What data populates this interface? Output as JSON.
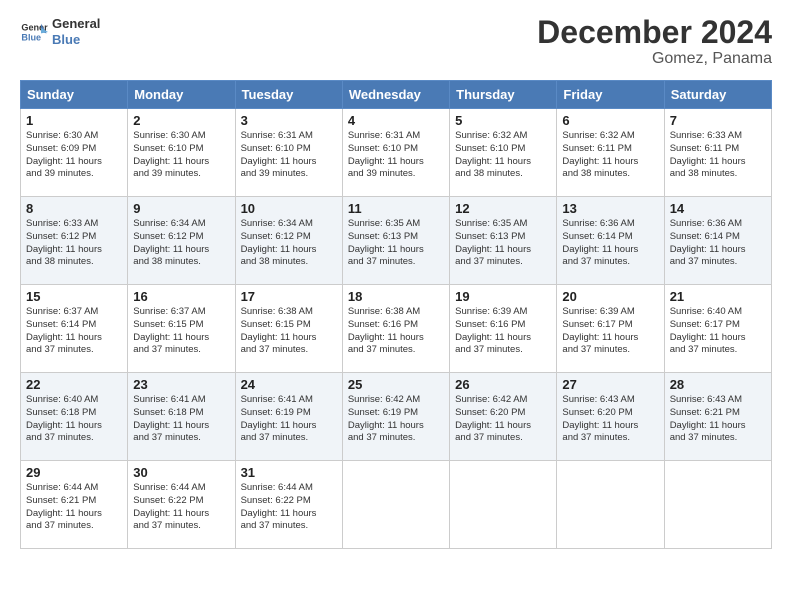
{
  "header": {
    "logo_line1": "General",
    "logo_line2": "Blue",
    "month_title": "December 2024",
    "location": "Gomez, Panama"
  },
  "weekdays": [
    "Sunday",
    "Monday",
    "Tuesday",
    "Wednesday",
    "Thursday",
    "Friday",
    "Saturday"
  ],
  "weeks": [
    [
      {
        "day": "1",
        "info": "Sunrise: 6:30 AM\nSunset: 6:09 PM\nDaylight: 11 hours\nand 39 minutes."
      },
      {
        "day": "2",
        "info": "Sunrise: 6:30 AM\nSunset: 6:10 PM\nDaylight: 11 hours\nand 39 minutes."
      },
      {
        "day": "3",
        "info": "Sunrise: 6:31 AM\nSunset: 6:10 PM\nDaylight: 11 hours\nand 39 minutes."
      },
      {
        "day": "4",
        "info": "Sunrise: 6:31 AM\nSunset: 6:10 PM\nDaylight: 11 hours\nand 39 minutes."
      },
      {
        "day": "5",
        "info": "Sunrise: 6:32 AM\nSunset: 6:10 PM\nDaylight: 11 hours\nand 38 minutes."
      },
      {
        "day": "6",
        "info": "Sunrise: 6:32 AM\nSunset: 6:11 PM\nDaylight: 11 hours\nand 38 minutes."
      },
      {
        "day": "7",
        "info": "Sunrise: 6:33 AM\nSunset: 6:11 PM\nDaylight: 11 hours\nand 38 minutes."
      }
    ],
    [
      {
        "day": "8",
        "info": "Sunrise: 6:33 AM\nSunset: 6:12 PM\nDaylight: 11 hours\nand 38 minutes."
      },
      {
        "day": "9",
        "info": "Sunrise: 6:34 AM\nSunset: 6:12 PM\nDaylight: 11 hours\nand 38 minutes."
      },
      {
        "day": "10",
        "info": "Sunrise: 6:34 AM\nSunset: 6:12 PM\nDaylight: 11 hours\nand 38 minutes."
      },
      {
        "day": "11",
        "info": "Sunrise: 6:35 AM\nSunset: 6:13 PM\nDaylight: 11 hours\nand 37 minutes."
      },
      {
        "day": "12",
        "info": "Sunrise: 6:35 AM\nSunset: 6:13 PM\nDaylight: 11 hours\nand 37 minutes."
      },
      {
        "day": "13",
        "info": "Sunrise: 6:36 AM\nSunset: 6:14 PM\nDaylight: 11 hours\nand 37 minutes."
      },
      {
        "day": "14",
        "info": "Sunrise: 6:36 AM\nSunset: 6:14 PM\nDaylight: 11 hours\nand 37 minutes."
      }
    ],
    [
      {
        "day": "15",
        "info": "Sunrise: 6:37 AM\nSunset: 6:14 PM\nDaylight: 11 hours\nand 37 minutes."
      },
      {
        "day": "16",
        "info": "Sunrise: 6:37 AM\nSunset: 6:15 PM\nDaylight: 11 hours\nand 37 minutes."
      },
      {
        "day": "17",
        "info": "Sunrise: 6:38 AM\nSunset: 6:15 PM\nDaylight: 11 hours\nand 37 minutes."
      },
      {
        "day": "18",
        "info": "Sunrise: 6:38 AM\nSunset: 6:16 PM\nDaylight: 11 hours\nand 37 minutes."
      },
      {
        "day": "19",
        "info": "Sunrise: 6:39 AM\nSunset: 6:16 PM\nDaylight: 11 hours\nand 37 minutes."
      },
      {
        "day": "20",
        "info": "Sunrise: 6:39 AM\nSunset: 6:17 PM\nDaylight: 11 hours\nand 37 minutes."
      },
      {
        "day": "21",
        "info": "Sunrise: 6:40 AM\nSunset: 6:17 PM\nDaylight: 11 hours\nand 37 minutes."
      }
    ],
    [
      {
        "day": "22",
        "info": "Sunrise: 6:40 AM\nSunset: 6:18 PM\nDaylight: 11 hours\nand 37 minutes."
      },
      {
        "day": "23",
        "info": "Sunrise: 6:41 AM\nSunset: 6:18 PM\nDaylight: 11 hours\nand 37 minutes."
      },
      {
        "day": "24",
        "info": "Sunrise: 6:41 AM\nSunset: 6:19 PM\nDaylight: 11 hours\nand 37 minutes."
      },
      {
        "day": "25",
        "info": "Sunrise: 6:42 AM\nSunset: 6:19 PM\nDaylight: 11 hours\nand 37 minutes."
      },
      {
        "day": "26",
        "info": "Sunrise: 6:42 AM\nSunset: 6:20 PM\nDaylight: 11 hours\nand 37 minutes."
      },
      {
        "day": "27",
        "info": "Sunrise: 6:43 AM\nSunset: 6:20 PM\nDaylight: 11 hours\nand 37 minutes."
      },
      {
        "day": "28",
        "info": "Sunrise: 6:43 AM\nSunset: 6:21 PM\nDaylight: 11 hours\nand 37 minutes."
      }
    ],
    [
      {
        "day": "29",
        "info": "Sunrise: 6:44 AM\nSunset: 6:21 PM\nDaylight: 11 hours\nand 37 minutes."
      },
      {
        "day": "30",
        "info": "Sunrise: 6:44 AM\nSunset: 6:22 PM\nDaylight: 11 hours\nand 37 minutes."
      },
      {
        "day": "31",
        "info": "Sunrise: 6:44 AM\nSunset: 6:22 PM\nDaylight: 11 hours\nand 37 minutes."
      },
      null,
      null,
      null,
      null
    ]
  ]
}
